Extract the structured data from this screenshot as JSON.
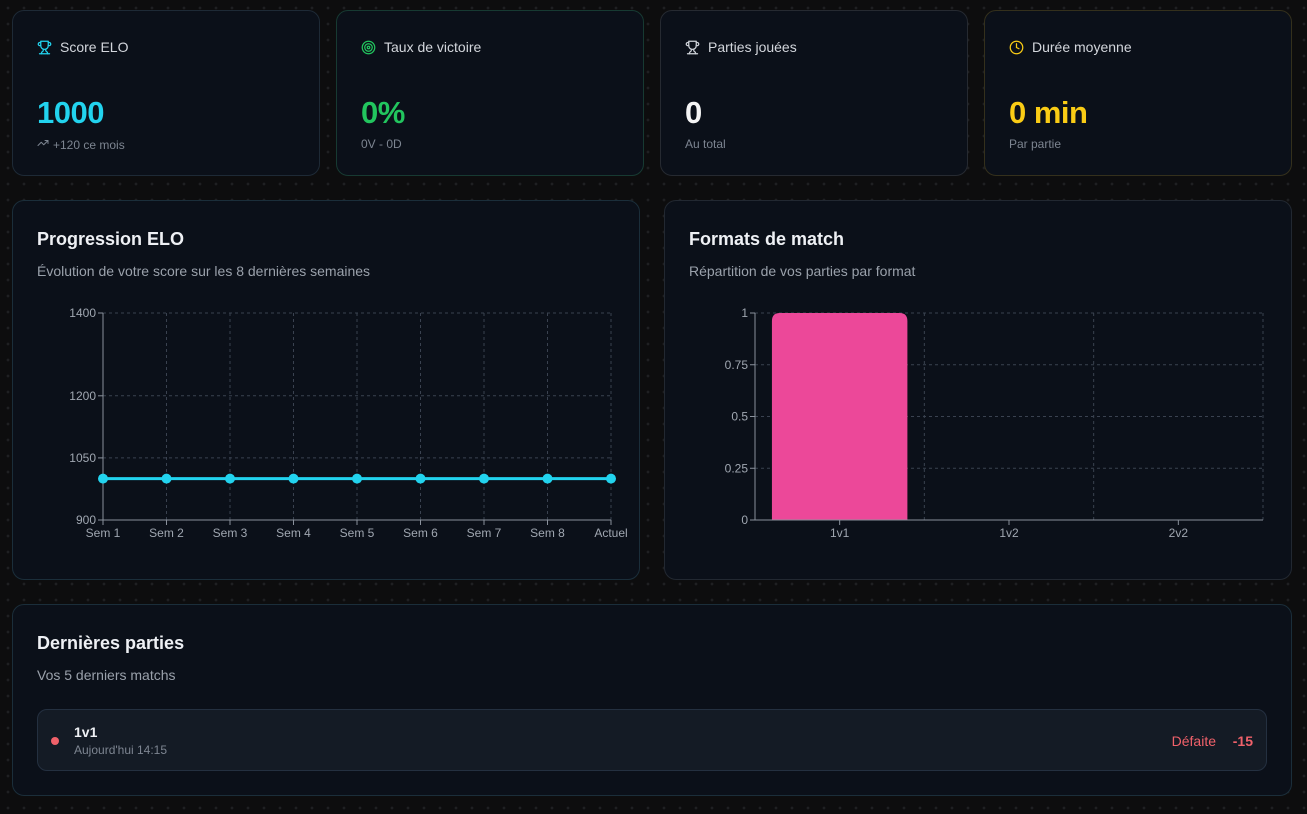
{
  "stats": [
    {
      "label": "Score ELO",
      "icon": "trophy-icon",
      "value": "1000",
      "sub": "+120 ce mois",
      "sub_icon": "trending-up-icon",
      "color": "#22d3ee"
    },
    {
      "label": "Taux de victoire",
      "icon": "target-icon",
      "value": "0%",
      "sub": "0V - 0D",
      "color": "#22c55e"
    },
    {
      "label": "Parties jouées",
      "icon": "trophy-icon",
      "value": "0",
      "sub": "Au total",
      "color": "#f5f5f5"
    },
    {
      "label": "Durée moyenne",
      "icon": "clock-icon",
      "value": "0 min",
      "sub": "Par partie",
      "color": "#facc15"
    }
  ],
  "elo_chart": {
    "title": "Progression ELO",
    "subtitle": "Évolution de votre score sur les 8 dernières semaines"
  },
  "format_chart": {
    "title": "Formats de match",
    "subtitle": "Répartition de vos parties par format"
  },
  "chart_data": [
    {
      "type": "line",
      "categories": [
        "Sem 1",
        "Sem 2",
        "Sem 3",
        "Sem 4",
        "Sem 5",
        "Sem 6",
        "Sem 7",
        "Sem 8",
        "Actuel"
      ],
      "values": [
        1000,
        1000,
        1000,
        1000,
        1000,
        1000,
        1000,
        1000,
        1000
      ],
      "yticks": [
        "900",
        "1050",
        "1200",
        "1400"
      ],
      "ylim": [
        900,
        1400
      ],
      "grid": true,
      "color": "#22d3ee"
    },
    {
      "type": "bar",
      "categories": [
        "1v1",
        "1v2",
        "2v2"
      ],
      "values": [
        1,
        0,
        0
      ],
      "yticks": [
        "0",
        "0.25",
        "0.5",
        "0.75",
        "1"
      ],
      "ylim": [
        0,
        1
      ],
      "grid": true,
      "color": "#ec4899"
    }
  ],
  "recent": {
    "title": "Dernières parties",
    "subtitle": "Vos 5 derniers matchs",
    "matches": [
      {
        "format": "1v1",
        "time": "Aujourd'hui 14:15",
        "result": "Défaite",
        "delta": "-15",
        "color": "#f0616a"
      }
    ]
  }
}
